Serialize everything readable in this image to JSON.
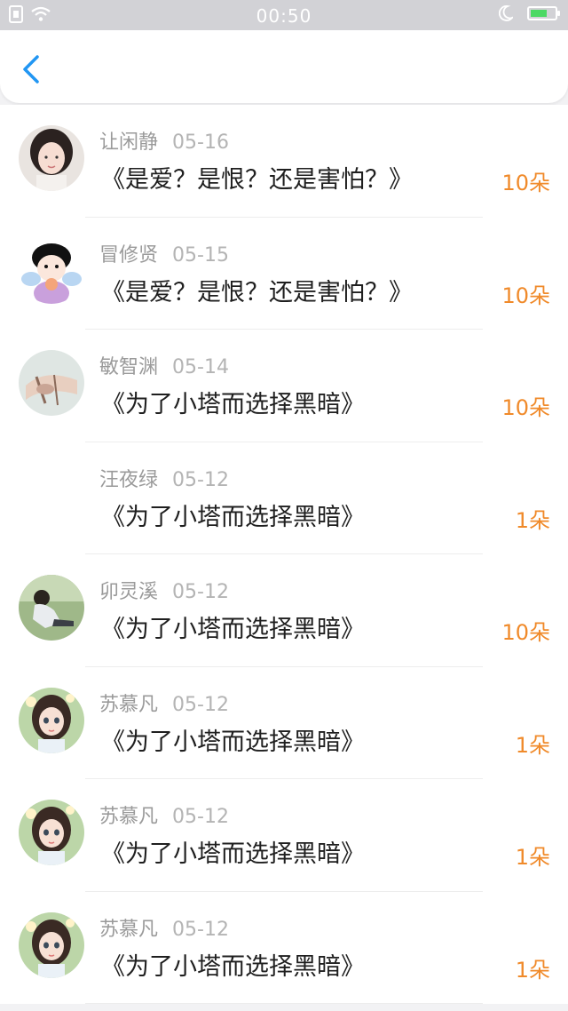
{
  "status_bar": {
    "time": "00:50",
    "icons": [
      "sim-icon",
      "wifi-icon",
      "moon-icon",
      "battery-icon"
    ]
  },
  "header": {
    "back_icon": "chevron-left-icon",
    "accent_color": "#2196f3"
  },
  "colors": {
    "count": "#f08a2a",
    "name": "#9a9a9a",
    "title": "#1f1f1f"
  },
  "items": [
    {
      "name": "让闲静",
      "date": "05-16",
      "title": "《是爱？是恨？还是害怕？》",
      "count": "10朵",
      "avatar": "girl-photo"
    },
    {
      "name": "冒修贤",
      "date": "05-15",
      "title": "《是爱？是恨？还是害怕？》",
      "count": "10朵",
      "avatar": "cartoon-girl"
    },
    {
      "name": "敏智渊",
      "date": "05-14",
      "title": "《为了小塔而选择黑暗》",
      "count": "10朵",
      "avatar": "hand-photo"
    },
    {
      "name": "汪夜绿",
      "date": "05-12",
      "title": "《为了小塔而选择黑暗》",
      "count": "1朵",
      "avatar": ""
    },
    {
      "name": "卯灵溪",
      "date": "05-12",
      "title": "《为了小塔而选择黑暗》",
      "count": "10朵",
      "avatar": "sitting-girl"
    },
    {
      "name": "苏慕凡",
      "date": "05-12",
      "title": "《为了小塔而选择黑暗》",
      "count": "1朵",
      "avatar": "doll-girl"
    },
    {
      "name": "苏慕凡",
      "date": "05-12",
      "title": "《为了小塔而选择黑暗》",
      "count": "1朵",
      "avatar": "doll-girl"
    },
    {
      "name": "苏慕凡",
      "date": "05-12",
      "title": "《为了小塔而选择黑暗》",
      "count": "1朵",
      "avatar": "doll-girl"
    }
  ]
}
